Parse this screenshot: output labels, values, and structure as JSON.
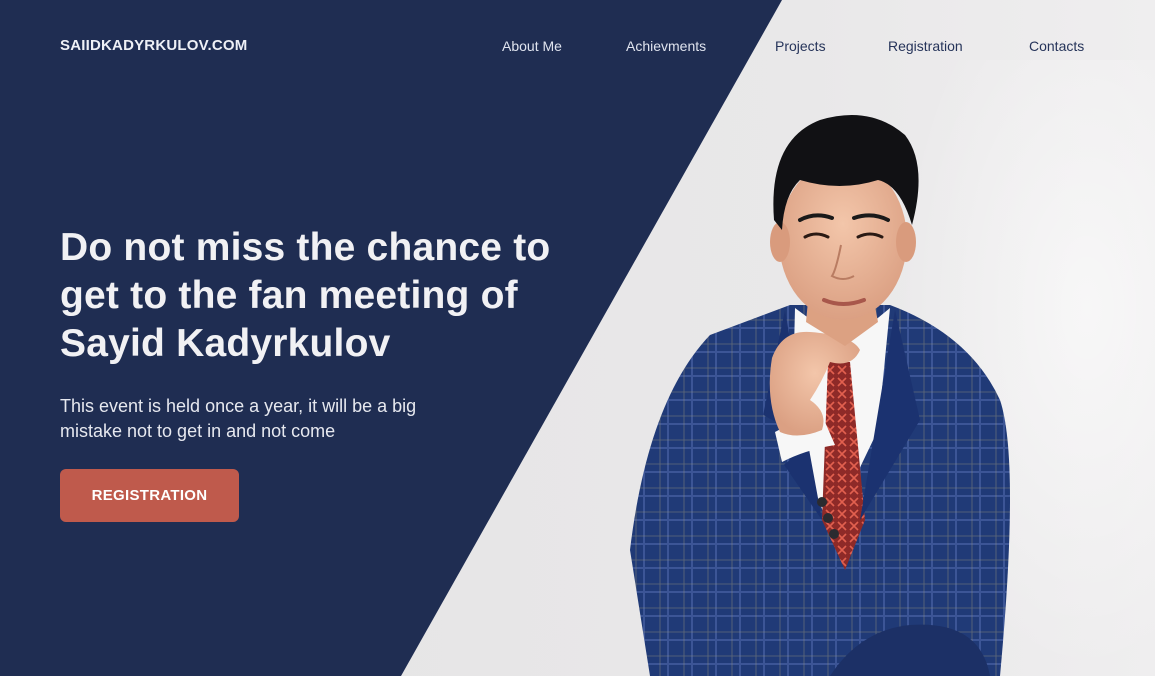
{
  "site": {
    "brand": "SAIIDKADYRKULOV.COM"
  },
  "nav": {
    "items": [
      {
        "label": "About Me"
      },
      {
        "label": "Achievments"
      },
      {
        "label": "Projects"
      },
      {
        "label": "Registration"
      },
      {
        "label": "Contacts"
      }
    ]
  },
  "hero": {
    "title": "Do not miss the chance to get to the fan meeting of Sayid Kadyrkulov",
    "subtitle": "This event is held once a year, it will be a big mistake not to get in and not come",
    "cta_label": "REGISTRATION"
  },
  "colors": {
    "dark_panel": "#1f2d52",
    "light_background": "#e6e5e6",
    "accent_button": "#bf5a4c",
    "nav_text_on_light": "#26345a",
    "suit": "#203a77",
    "tie": "#c9463c"
  }
}
